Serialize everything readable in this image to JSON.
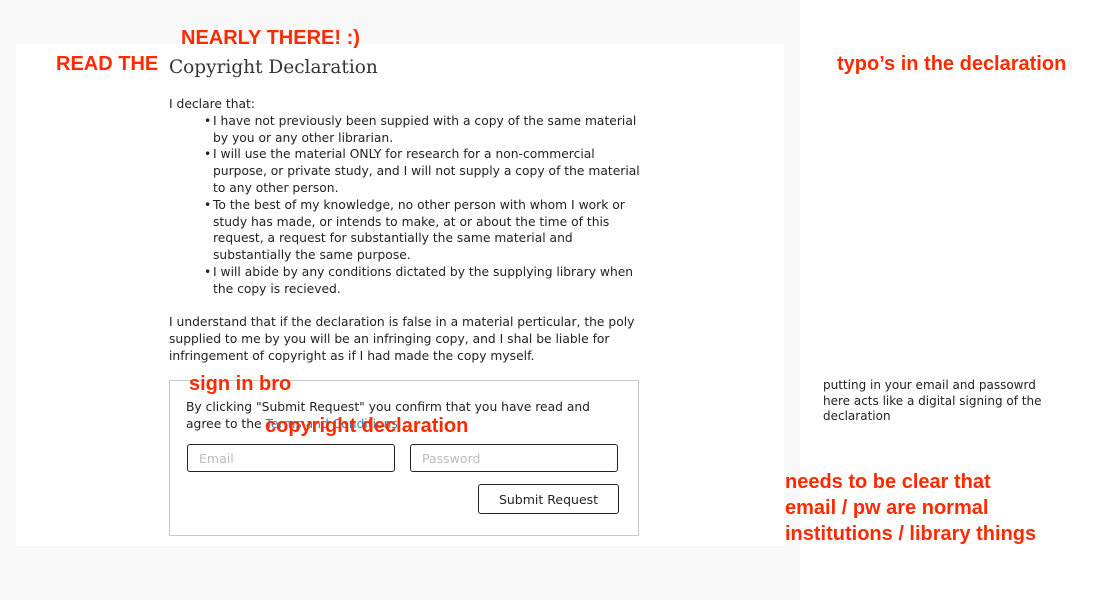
{
  "page": {
    "title": "Copyright Declaration",
    "intro": "I declare that:",
    "declarations": [
      "I have not previously been suppied with a copy of the same material by you or any other librarian.",
      "I will use the material ONLY for research for a non-commercial purpose, or private study, and I will not supply a copy of the material to any other person.",
      "To the best of my knowledge, no other person with whom I work or study has made, or intends to make, at or about the time of this request, a request for substantially the same material and substantially the same purpose.",
      "I will abide by any conditions dictated by the supplying library when the copy is recieved."
    ],
    "understanding": "I understand that if the declaration is false in a material perticular, the poly supplied to me by you will be an infringing copy, and I shal be liable for infringement of copyright as if I had made the copy myself."
  },
  "signin": {
    "text_before": "By clicking \"Submit Request\" you confirm that you have read and agree to the ",
    "link": "Terms and Conditions",
    "email_placeholder": "Email",
    "password_placeholder": "Password",
    "submit_label": "Submit Request"
  },
  "annotations": {
    "nearly_there": "NEARLY THERE! :)",
    "read_the": "READ THE",
    "typos": "typo’s in the declaration",
    "sign_in": "sign in bro",
    "copyright": "copyright declaration",
    "clear_1": "needs to be clear that",
    "clear_2": "email / pw are normal",
    "clear_3": "institutions / library things",
    "note": "putting in your email and passowrd here acts like a digital signing of the declaration",
    "color": "#ff2a00"
  }
}
